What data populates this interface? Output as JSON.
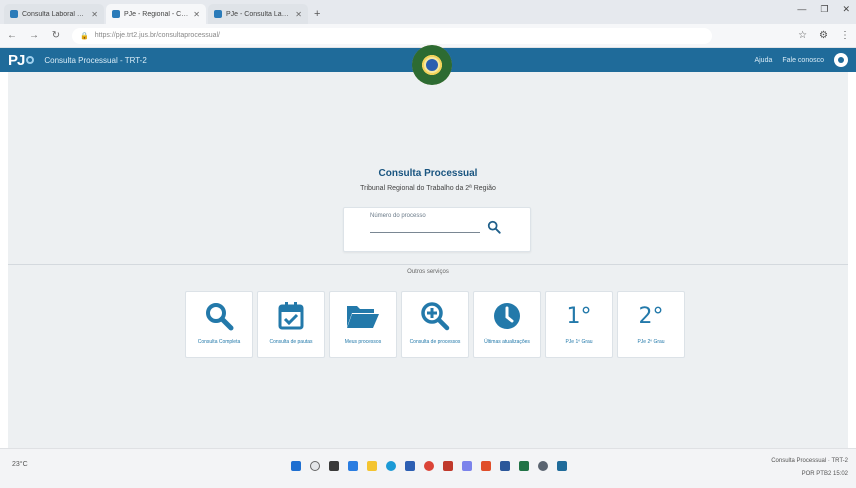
{
  "browser": {
    "tabs": [
      {
        "label": "Consulta Laboral Eletrônica - PJE",
        "active": false
      },
      {
        "label": "PJe - Regional - Consulta Proc.",
        "active": true
      },
      {
        "label": "PJe - Consulta Laboral Eletrônica",
        "active": false
      }
    ],
    "new_tab": "+",
    "url": "https://pje.trt2.jus.br/consultaprocessual/",
    "window_controls": [
      "—",
      "❐",
      "✕"
    ]
  },
  "header": {
    "logo": "PJ",
    "title": "Consulta Processual - TRT-2",
    "links": [
      "Ajuda",
      "Fale conosco"
    ]
  },
  "main": {
    "title": "Consulta Processual",
    "subtitle": "Tribunal Regional do Trabalho da 2ª Região",
    "search": {
      "label": "Número do processo"
    },
    "services_title": "Outros serviços",
    "services": [
      {
        "icon": "search-icon",
        "label": "Consulta Completa"
      },
      {
        "icon": "calendar-check-icon",
        "label": "Consulta de pautas"
      },
      {
        "icon": "folder-open-icon",
        "label": "Meus processos"
      },
      {
        "icon": "zoom-in-icon",
        "label": "Consulta de processos"
      },
      {
        "icon": "clock-icon",
        "label": "Últimas atualizações"
      },
      {
        "big": "1°",
        "label": "PJe 1º Grau"
      },
      {
        "big": "2°",
        "label": "PJe 2º Grau"
      }
    ]
  },
  "taskbar": {
    "weather": "23°C",
    "tray_line1": "Consulta Processual · TRT-2",
    "tray_status": "POR  PTB2  15:02"
  },
  "colors": {
    "header_bg": "#1f6b9a",
    "accent": "#2379aa",
    "content_bg": "#edf0f2"
  }
}
